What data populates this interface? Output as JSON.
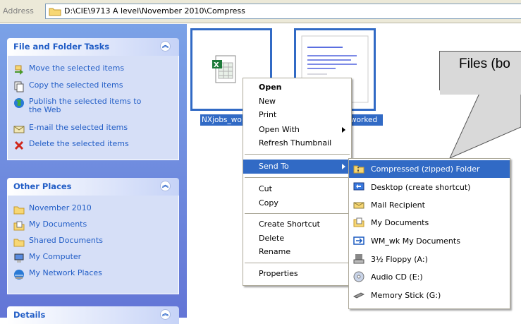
{
  "address": {
    "label": "Address",
    "path": "D:\\CIE\\9713 A level\\November 2010\\Compress"
  },
  "task_pane": {
    "file_tasks": {
      "title": "File and Folder Tasks",
      "items": [
        {
          "label": "Move the selected items",
          "icon": "move-icon"
        },
        {
          "label": "Copy the selected items",
          "icon": "copy-icon"
        },
        {
          "label": "Publish the selected items to the Web",
          "icon": "globe-icon"
        },
        {
          "label": "E-mail the selected items",
          "icon": "email-icon"
        },
        {
          "label": "Delete the selected items",
          "icon": "delete-x-icon"
        }
      ]
    },
    "other_places": {
      "title": "Other Places",
      "items": [
        {
          "label": "November 2010",
          "icon": "folder-icon"
        },
        {
          "label": "My Documents",
          "icon": "my-documents-icon"
        },
        {
          "label": "Shared Documents",
          "icon": "folder-icon"
        },
        {
          "label": "My Computer",
          "icon": "computer-icon"
        },
        {
          "label": "My Network Places",
          "icon": "network-icon"
        }
      ]
    },
    "details": {
      "title": "Details"
    }
  },
  "files": [
    {
      "label": "NXjobs_wo",
      "icon": "excel-file-icon"
    },
    {
      "label": "worked",
      "icon": "document-file-icon"
    }
  ],
  "context_menu": {
    "open": "Open",
    "new": "New",
    "print": "Print",
    "open_with": "Open With",
    "refresh_thumbnail": "Refresh Thumbnail",
    "send_to": "Send To",
    "cut": "Cut",
    "copy": "Copy",
    "create_shortcut": "Create Shortcut",
    "delete": "Delete",
    "rename": "Rename",
    "properties": "Properties"
  },
  "send_to_menu": {
    "items": [
      {
        "label": "Compressed (zipped) Folder",
        "icon": "zip-folder-icon"
      },
      {
        "label": "Desktop (create shortcut)",
        "icon": "desktop-icon"
      },
      {
        "label": "Mail Recipient",
        "icon": "mail-icon"
      },
      {
        "label": "My Documents",
        "icon": "my-documents-icon"
      },
      {
        "label": "WM_wk My Documents",
        "icon": "network-drive-icon"
      },
      {
        "label": "3½ Floppy (A:)",
        "icon": "floppy-icon"
      },
      {
        "label": "Audio CD (E:)",
        "icon": "cd-icon"
      },
      {
        "label": "Memory Stick (G:)",
        "icon": "memory-stick-icon"
      }
    ]
  },
  "callout": {
    "text": "Files (bo"
  },
  "colors": {
    "selection": "#316ac5",
    "task_pane_top": "#7ba2e7",
    "task_pane_bottom": "#6375d6",
    "task_link": "#215dc6",
    "callout_fill": "#d9d9d9"
  }
}
